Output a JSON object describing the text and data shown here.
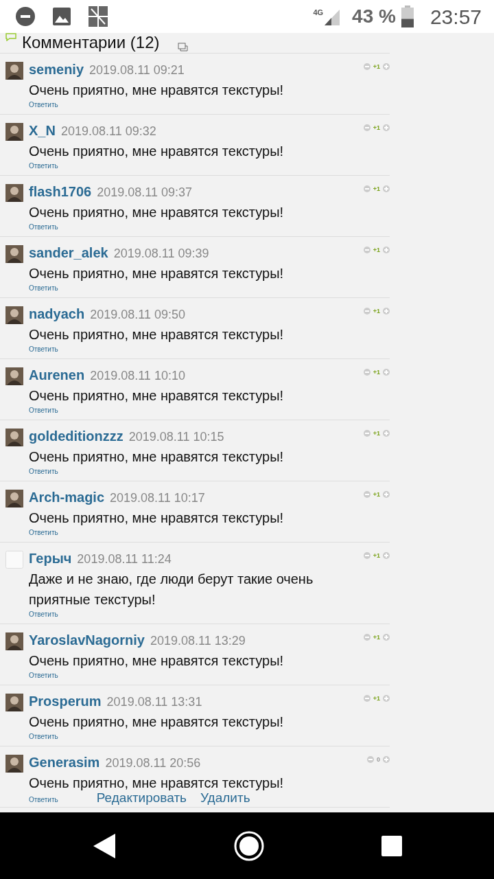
{
  "status_bar": {
    "network": "4G",
    "battery": "43 %",
    "time": "23:57"
  },
  "header": {
    "title": "Комментарии (12)"
  },
  "comments": [
    {
      "author": "semeniy",
      "date": "2019.08.11 09:21",
      "text": "Очень приятно, мне нравятся текстуры!",
      "reply": "Ответить",
      "score": "+1",
      "positive": true,
      "avatar": true
    },
    {
      "author": "X_N",
      "date": "2019.08.11 09:32",
      "text": "Очень приятно, мне нравятся текстуры!",
      "reply": "Ответить",
      "score": "+1",
      "positive": true,
      "avatar": true
    },
    {
      "author": "flash1706",
      "date": "2019.08.11 09:37",
      "text": "Очень приятно, мне нравятся текстуры!",
      "reply": "Ответить",
      "score": "+1",
      "positive": true,
      "avatar": true
    },
    {
      "author": "sander_alek",
      "date": "2019.08.11 09:39",
      "text": "Очень приятно, мне нравятся текстуры!",
      "reply": "Ответить",
      "score": "+1",
      "positive": true,
      "avatar": true
    },
    {
      "author": "nadyach",
      "date": "2019.08.11 09:50",
      "text": "Очень приятно, мне нравятся текстуры!",
      "reply": "Ответить",
      "score": "+1",
      "positive": true,
      "avatar": true
    },
    {
      "author": "Aurenen",
      "date": "2019.08.11 10:10",
      "text": "Очень приятно, мне нравятся текстуры!",
      "reply": "Ответить",
      "score": "+1",
      "positive": true,
      "avatar": true
    },
    {
      "author": "goldeditionzzz",
      "date": "2019.08.11 10:15",
      "text": "Очень приятно, мне нравятся текстуры!",
      "reply": "Ответить",
      "score": "+1",
      "positive": true,
      "avatar": true
    },
    {
      "author": "Arch-magic",
      "date": "2019.08.11 10:17",
      "text": "Очень приятно, мне нравятся текстуры!",
      "reply": "Ответить",
      "score": "+1",
      "positive": true,
      "avatar": true
    },
    {
      "author": "Герыч",
      "date": "2019.08.11 11:24",
      "text": "Даже и не знаю, где люди берут такие очень приятные текстуры!",
      "reply": "Ответить",
      "score": "+1",
      "positive": true,
      "avatar": false
    },
    {
      "author": "YaroslavNagorniy",
      "date": "2019.08.11 13:29",
      "text": "Очень приятно, мне нравятся текстуры!",
      "reply": "Ответить",
      "score": "+1",
      "positive": true,
      "avatar": true
    },
    {
      "author": "Prosperum",
      "date": "2019.08.11 13:31",
      "text": "Очень приятно, мне нравятся текстуры!",
      "reply": "Ответить",
      "score": "+1",
      "positive": true,
      "avatar": true
    },
    {
      "author": "Generasim",
      "date": "2019.08.11 20:56",
      "text": "Очень приятно, мне нравятся текстуры!",
      "reply": "Ответить",
      "score": "0",
      "positive": false,
      "avatar": true,
      "actions": [
        "Редактировать",
        "Удалить"
      ]
    }
  ]
}
